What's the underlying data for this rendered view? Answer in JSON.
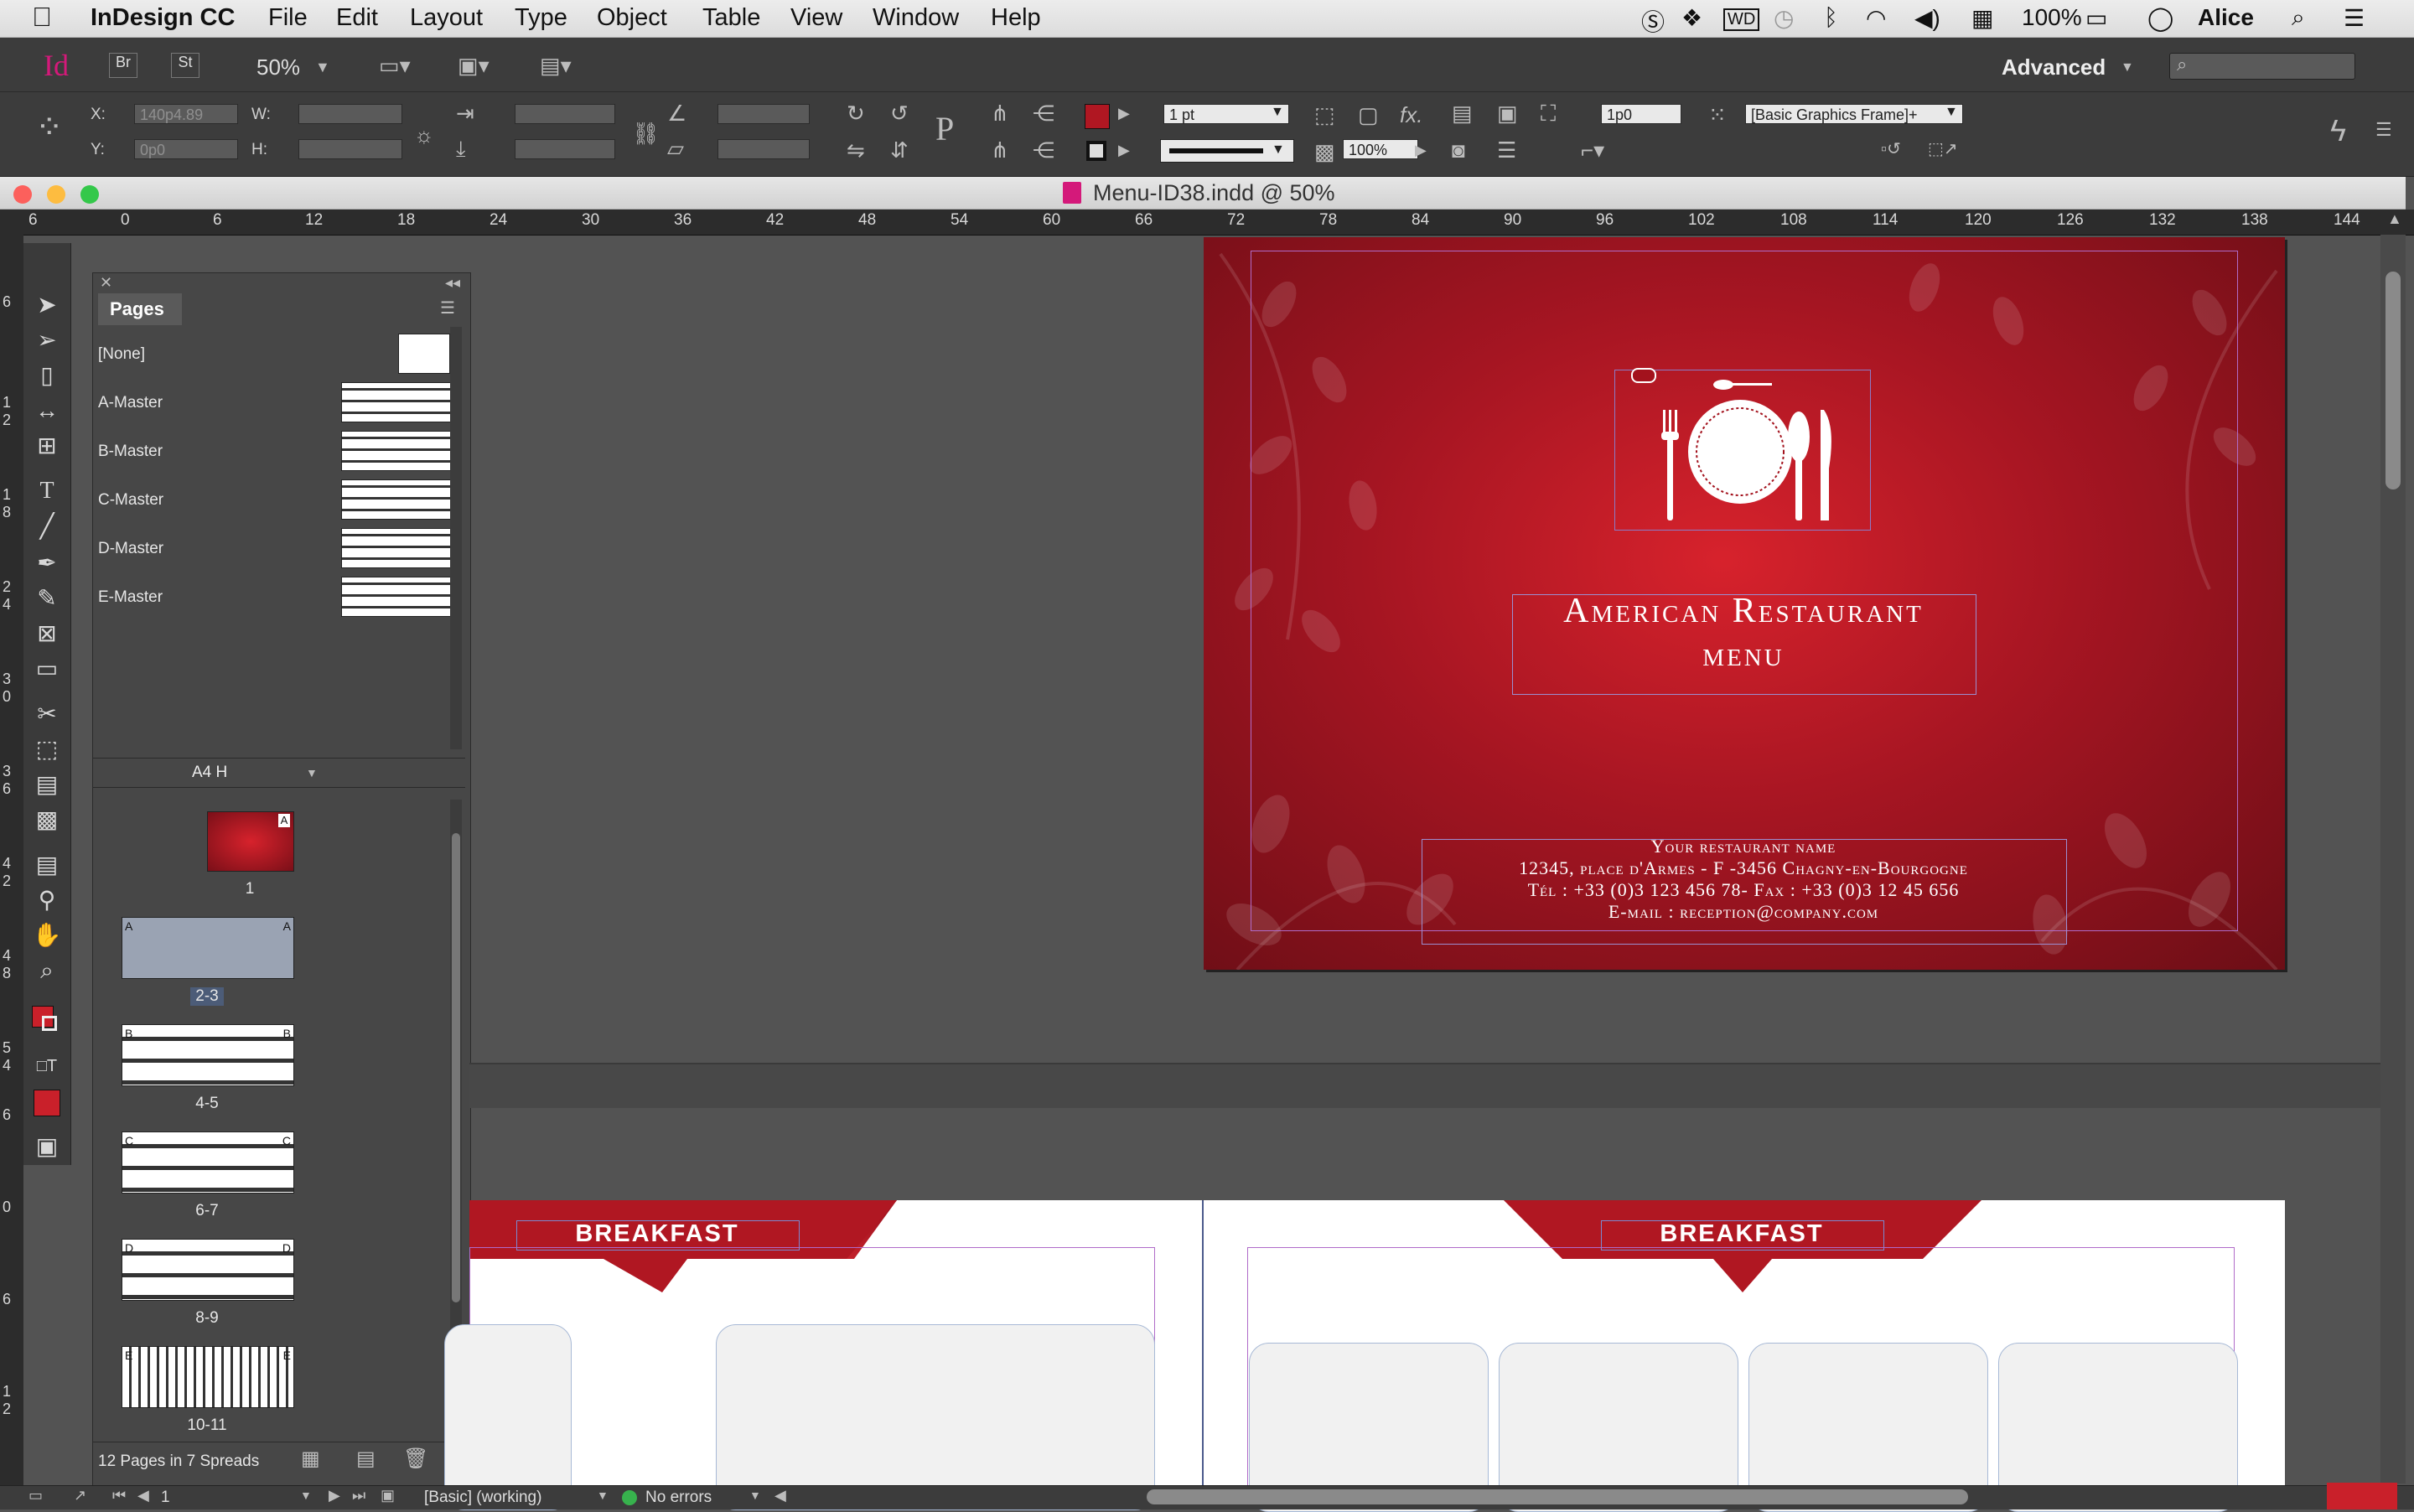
{
  "menubar": {
    "app": "InDesign CC",
    "items": [
      "File",
      "Edit",
      "Layout",
      "Type",
      "Object",
      "Table",
      "View",
      "Window",
      "Help"
    ],
    "battery": "100%",
    "user": "Alice"
  },
  "appbar": {
    "logo": "Id",
    "bridge": "Br",
    "stock": "St",
    "zoom": "50%",
    "workspace": "Advanced"
  },
  "control": {
    "x_label": "X:",
    "x_value": "140p4.89",
    "y_label": "Y:",
    "y_value": "0p0",
    "w_label": "W:",
    "h_label": "H:",
    "stroke_weight": "1 pt",
    "opacity": "100%",
    "offset": "1p0",
    "object_style": "[Basic Graphics Frame]+"
  },
  "document": {
    "title": "Menu-ID38.indd @ 50%"
  },
  "ruler": {
    "ticks": [
      "6",
      "0",
      "6",
      "12",
      "18",
      "24",
      "30",
      "36",
      "42",
      "48",
      "54",
      "60",
      "66",
      "72",
      "78",
      "84",
      "90",
      "96",
      "102",
      "108",
      "114",
      "120",
      "126",
      "132",
      "138",
      "144"
    ],
    "vticks": [
      "6",
      "1\n2",
      "1\n8",
      "2\n4",
      "3\n0",
      "3\n6",
      "4\n2",
      "4\n8",
      "5\n4",
      "6",
      "0",
      "6",
      "1\n2"
    ]
  },
  "pages_panel": {
    "tab": "Pages",
    "masters": [
      "[None]",
      "A-Master",
      "B-Master",
      "C-Master",
      "D-Master",
      "E-Master"
    ],
    "page_size": "A4 H",
    "spreads": [
      {
        "label": "1"
      },
      {
        "label": "2-3",
        "left": "A",
        "right": "A"
      },
      {
        "label": "4-5",
        "left": "B",
        "right": "B"
      },
      {
        "label": "6-7",
        "left": "C",
        "right": "C"
      },
      {
        "label": "8-9",
        "left": "D",
        "right": "D"
      },
      {
        "label": "10-11",
        "left": "E",
        "right": "E"
      }
    ],
    "footer": "12 Pages in 7 Spreads"
  },
  "cover": {
    "title_line1": "American Restaurant",
    "title_line2": "menu",
    "name": "Your restaurant name",
    "address": "12345, place d'Armes - F -3456  Chagny-en-Bourgogne",
    "phone": "Tél : +33 (0)3 123 456 78- Fax : +33 (0)3 12 45 656",
    "email": "E-mail : reception@company.com"
  },
  "spread2": {
    "banner_left": "BREAKFAST",
    "banner_right": "BREAKFAST"
  },
  "status": {
    "page": "1",
    "style": "[Basic] (working)",
    "preflight": "No errors"
  },
  "colors": {
    "brand_red": "#b01722",
    "id_pink": "#d4197a"
  }
}
